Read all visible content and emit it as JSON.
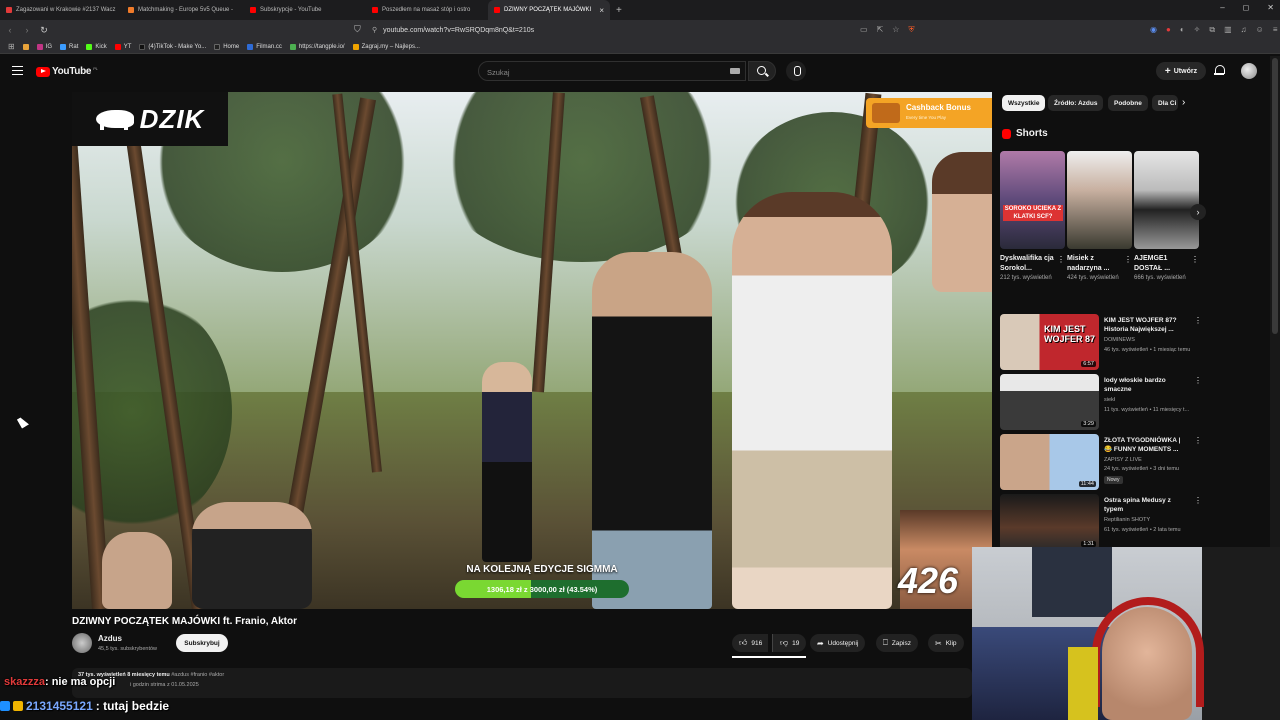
{
  "browser": {
    "tabs": [
      {
        "label": "Zagazowani w Krakowie #2137 Wacz",
        "color": "#e23a3a",
        "active": false
      },
      {
        "label": "Matchmaking - Europe 5v5 Queue -",
        "color": "#f07b2a",
        "active": false
      },
      {
        "label": "Subskrypcje - YouTube",
        "color": "#ff0000",
        "active": false
      },
      {
        "label": "Poszedłem na masaż stóp i ostro",
        "color": "#ff0000",
        "active": false
      },
      {
        "label": "DZIWNY POCZĄTEK MAJÓWKI",
        "color": "#ff0000",
        "active": true
      }
    ],
    "new_tab": "+",
    "close_tab": "×",
    "url": "youtube.com/watch?v=RwSRQDqm8nQ&t=210s",
    "bookmarks": [
      {
        "label": "IG",
        "color": "#c13584"
      },
      {
        "label": "Rat",
        "color": "#3b9cff"
      },
      {
        "label": "Kick",
        "color": "#53fc18"
      },
      {
        "label": "YT",
        "color": "#ff0000"
      },
      {
        "label": "(4)TikTok - Make Yo...",
        "color": "#111111"
      },
      {
        "label": "Home",
        "color": "#222222"
      },
      {
        "label": "Filman.cc",
        "color": "#2e6bd6"
      },
      {
        "label": "https://tangple.io/",
        "color": "#4caf50"
      },
      {
        "label": "Zagraj.my – Najleps...",
        "color": "#f0a400"
      }
    ],
    "window_controls": [
      "–",
      "◻",
      "✕"
    ]
  },
  "youtube": {
    "logo_text": "YouTube",
    "logo_region": "PL",
    "search_placeholder": "Szukaj",
    "create_label": "Utwórz",
    "create_icon": "+"
  },
  "player": {
    "brand_logo": "DZIK",
    "cashback_title": "Cashback Bonus",
    "cashback_sub": "Every time You Play",
    "donation_label": "NA KOLEJNĄ EDYCJE SIGMMA",
    "donation_text": "1306,18 zł z 3000,00 zł (43.54%)",
    "donation_progress": 0.4354,
    "overlay_number": "426"
  },
  "video": {
    "title": "DZIWNY POCZĄTEK MAJÓWKI ft. Franio, Aktor",
    "channel": "Azdus",
    "subscribers": "45,5 tys. subskrybentów",
    "subscribe_label": "Subskrybuj",
    "likes": "916",
    "dislikes": "19",
    "share_label": "Udostępnij",
    "save_label": "Zapisz",
    "clip_label": "Klip",
    "views_date": "37 tys. wyświetleń  8 miesięcy temu",
    "hashtags": "#azdus #franio #aktor",
    "desc_line2": "i godzin strima z 01.05.2025"
  },
  "chat": [
    {
      "user": "skazzza",
      "message": ": nie ma opcji"
    },
    {
      "user": "2131455121",
      "message": ": tutaj bedzie"
    }
  ],
  "sidebar": {
    "chips": [
      "Wszystkie",
      "Źródło: Azdus",
      "Podobne",
      "Dla Ci"
    ],
    "shorts_title": "Shorts",
    "shorts": [
      {
        "title": "Dyskwalifika cja Sorokol...",
        "views": "212 tys. wyświetleń",
        "overlay": "SOROKO UCIEKA Z KLATKI SCF?"
      },
      {
        "title": "Misiek z nadarzyna ...",
        "views": "424 tys. wyświetleń",
        "overlay": ""
      },
      {
        "title": "AJEMGE1 DOSTAŁ ...",
        "views": "666 tys. wyświetleń",
        "overlay": ""
      }
    ],
    "recommended": [
      {
        "title": "KIM JEST WOJFER 87? Historia Największej ...",
        "channel": "DOMINEWS",
        "meta": "46 tys. wyświetleń • 1 miesiąc temu",
        "duration": "6:57",
        "thumb_text": "KIM JEST WOJFER 87",
        "badge": ""
      },
      {
        "title": "lody włoskie bardzo smaczne",
        "channel": "siekł",
        "meta": "11 tys. wyświetleń • 11 miesięcy t...",
        "duration": "3:29",
        "thumb_text": "",
        "badge": ""
      },
      {
        "title": "ZŁOTA TYGODNIÓWKA | 😂 FUNNY MOMENTS ...",
        "channel": "ZAPISY Z LIVE",
        "meta": "24 tys. wyświetleń • 3 dni temu",
        "duration": "11:44",
        "thumb_text": "",
        "badge": "Nowy"
      },
      {
        "title": "Ostra spina Medusy z typem",
        "channel": "Reptilianin SHOTY",
        "meta": "61 tys. wyświetleń • 2 lata temu",
        "duration": "1:31",
        "thumb_text": "",
        "badge": ""
      }
    ]
  },
  "colors": {
    "accent_red": "#ff0000",
    "background": "#0f0f0f",
    "donation_fill": "#7ad832",
    "cashback": "#f4a425"
  }
}
